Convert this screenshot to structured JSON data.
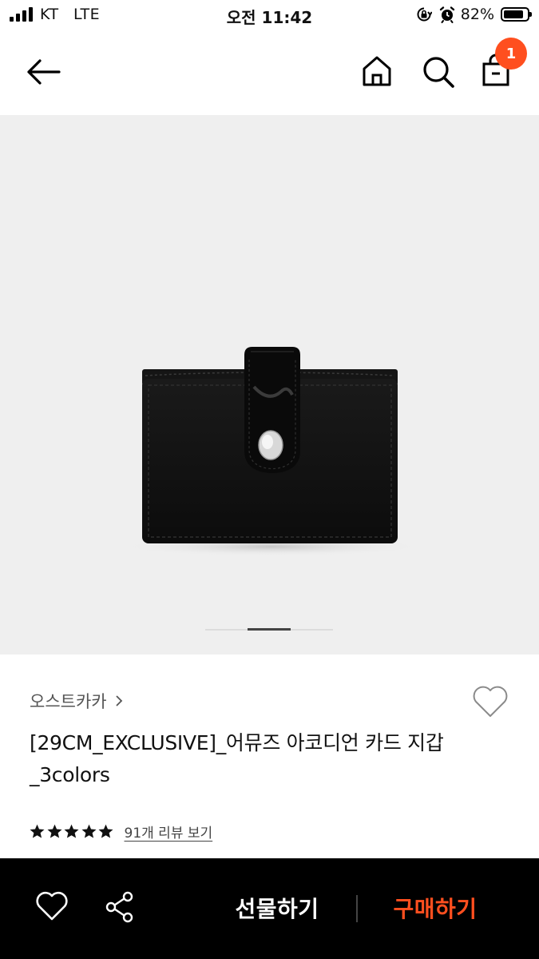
{
  "status_bar": {
    "carrier": "KT",
    "network": "LTE",
    "time": "오전 11:42",
    "battery": "82%"
  },
  "nav": {
    "cart_count": "1",
    "icons": [
      "back-arrow-icon",
      "home-icon",
      "search-icon",
      "shopping-bag-icon"
    ]
  },
  "product": {
    "brand": "오스트카카",
    "title": "[29CM_EXCLUSIVE]_어뮤즈 아코디언 카드 지갑_3colors",
    "rating": 5,
    "review_link": "91개 리뷰 보기",
    "image_page": 2,
    "image_pages": 3
  },
  "bottom_bar": {
    "gift_label": "선물하기",
    "buy_label": "구매하기",
    "icons": [
      "heart-icon",
      "share-icon"
    ]
  },
  "colors": {
    "accent": "#ff4f1f",
    "bottom_bar_bg": "#000000",
    "image_bg": "#efefef"
  }
}
